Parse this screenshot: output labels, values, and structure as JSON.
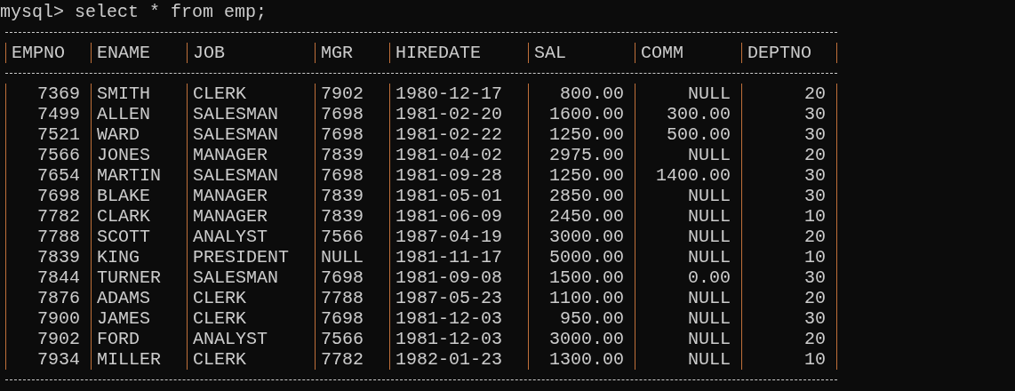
{
  "prompt": "mysql> select * from emp;",
  "table": {
    "columns": [
      {
        "label": "EMPNO",
        "right_aligned": true
      },
      {
        "label": "ENAME",
        "right_aligned": false
      },
      {
        "label": "JOB",
        "right_aligned": false
      },
      {
        "label": "MGR",
        "right_aligned": false
      },
      {
        "label": "HIREDATE",
        "right_aligned": false
      },
      {
        "label": "SAL",
        "right_aligned": true
      },
      {
        "label": "COMM",
        "right_aligned": true
      },
      {
        "label": "DEPTNO",
        "right_aligned": true
      }
    ],
    "rows": [
      [
        "7369",
        "SMITH",
        "CLERK",
        "7902",
        "1980-12-17",
        "800.00",
        "NULL",
        "20"
      ],
      [
        "7499",
        "ALLEN",
        "SALESMAN",
        "7698",
        "1981-02-20",
        "1600.00",
        "300.00",
        "30"
      ],
      [
        "7521",
        "WARD",
        "SALESMAN",
        "7698",
        "1981-02-22",
        "1250.00",
        "500.00",
        "30"
      ],
      [
        "7566",
        "JONES",
        "MANAGER",
        "7839",
        "1981-04-02",
        "2975.00",
        "NULL",
        "20"
      ],
      [
        "7654",
        "MARTIN",
        "SALESMAN",
        "7698",
        "1981-09-28",
        "1250.00",
        "1400.00",
        "30"
      ],
      [
        "7698",
        "BLAKE",
        "MANAGER",
        "7839",
        "1981-05-01",
        "2850.00",
        "NULL",
        "30"
      ],
      [
        "7782",
        "CLARK",
        "MANAGER",
        "7839",
        "1981-06-09",
        "2450.00",
        "NULL",
        "10"
      ],
      [
        "7788",
        "SCOTT",
        "ANALYST",
        "7566",
        "1987-04-19",
        "3000.00",
        "NULL",
        "20"
      ],
      [
        "7839",
        "KING",
        "PRESIDENT",
        "NULL",
        "1981-11-17",
        "5000.00",
        "NULL",
        "10"
      ],
      [
        "7844",
        "TURNER",
        "SALESMAN",
        "7698",
        "1981-09-08",
        "1500.00",
        "0.00",
        "30"
      ],
      [
        "7876",
        "ADAMS",
        "CLERK",
        "7788",
        "1987-05-23",
        "1100.00",
        "NULL",
        "20"
      ],
      [
        "7900",
        "JAMES",
        "CLERK",
        "7698",
        "1981-12-03",
        "950.00",
        "NULL",
        "30"
      ],
      [
        "7902",
        "FORD",
        "ANALYST",
        "7566",
        "1981-12-03",
        "3000.00",
        "NULL",
        "20"
      ],
      [
        "7934",
        "MILLER",
        "CLERK",
        "7782",
        "1982-01-23",
        "1300.00",
        "NULL",
        "10"
      ]
    ]
  }
}
